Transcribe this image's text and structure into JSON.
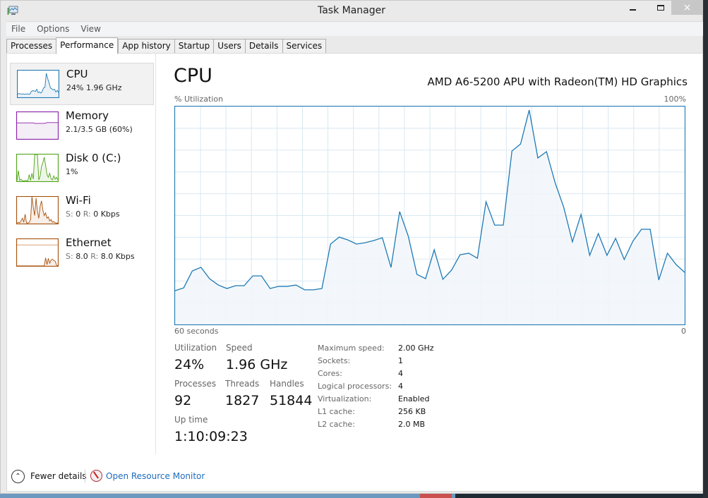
{
  "window": {
    "title": "Task Manager",
    "app_icon": "task-manager-icon",
    "controls": {
      "minimize": "minimize-icon",
      "maximize": "maximize-icon",
      "close": "×"
    }
  },
  "menu": [
    "File",
    "Options",
    "View"
  ],
  "tabs": [
    {
      "label": "Processes",
      "active": false
    },
    {
      "label": "Performance",
      "active": true
    },
    {
      "label": "App history",
      "active": false
    },
    {
      "label": "Startup",
      "active": false
    },
    {
      "label": "Users",
      "active": false
    },
    {
      "label": "Details",
      "active": false
    },
    {
      "label": "Services",
      "active": false
    }
  ],
  "sidebar": {
    "items": [
      {
        "name": "CPU",
        "sub": "24%  1.96 GHz",
        "color": "#1f7ab5",
        "fill": "#eaf2f8",
        "selected": true
      },
      {
        "name": "Memory",
        "sub": "2.1/3.5 GB (60%)",
        "color": "#8b1fa9",
        "fill": "#f4eef6",
        "selected": false
      },
      {
        "name": "Disk 0 (C:)",
        "sub": "1%",
        "color": "#4fa419",
        "fill": "#eef6e8",
        "selected": false
      },
      {
        "name": "Wi-Fi",
        "sub_parts": {
          "s_label": "S:",
          "s_value": "0",
          "r_label": "R:",
          "r_value": "0 Kbps"
        },
        "color": "#a7500b",
        "fill": "#f7efe8",
        "selected": false
      },
      {
        "name": "Ethernet",
        "sub_parts": {
          "s_label": "S:",
          "s_value": "8.0",
          "r_label": "R:",
          "r_value": "8.0 Kbps"
        },
        "color": "#a7500b",
        "fill": "#f7efe8",
        "selected": false
      }
    ]
  },
  "main": {
    "title": "CPU",
    "model": "AMD A6-5200 APU with Radeon(TM) HD Graphics",
    "stats": {
      "utilization_label": "Utilization",
      "utilization": "24%",
      "speed_label": "Speed",
      "speed": "1.96 GHz",
      "processes_label": "Processes",
      "processes": "92",
      "threads_label": "Threads",
      "threads": "1827",
      "handles_label": "Handles",
      "handles": "51844",
      "uptime_label": "Up time",
      "uptime": "1:10:09:23"
    },
    "details": [
      {
        "label": "Maximum speed:",
        "value": "2.00 GHz"
      },
      {
        "label": "Sockets:",
        "value": "1"
      },
      {
        "label": "Cores:",
        "value": "4"
      },
      {
        "label": "Logical processors:",
        "value": "4"
      },
      {
        "label": "Virtualization:",
        "value": "Enabled"
      },
      {
        "label": "L1 cache:",
        "value": "256 KB"
      },
      {
        "label": "L2 cache:",
        "value": "2.0 MB"
      }
    ]
  },
  "footer": {
    "fewer_details": "Fewer details",
    "open_resource_monitor": "Open Resource Monitor"
  },
  "chart_data": {
    "type": "area",
    "title": "CPU",
    "ylabel": "% Utilization",
    "ymax_label": "100%",
    "xlabel_left": "60 seconds",
    "xlabel_right": "0",
    "ylim": [
      0,
      100
    ],
    "xlim": [
      60,
      0
    ],
    "grid": true,
    "grid_rows": 10,
    "grid_cols": 20,
    "line_color": "#1f7ab5",
    "fill_color": "#f1f6fa",
    "grid_color": "#d9e8f2",
    "series": [
      {
        "name": "CPU",
        "values": [
          15.5,
          16.8,
          24.6,
          26.2,
          21.0,
          18.1,
          16.5,
          17.8,
          17.8,
          22.3,
          22.3,
          16.5,
          17.5,
          17.5,
          18.1,
          15.9,
          15.9,
          16.5,
          36.9,
          40.1,
          38.8,
          36.9,
          37.5,
          38.5,
          39.8,
          26.2,
          51.8,
          40.5,
          23.0,
          21.0,
          34.3,
          20.7,
          24.9,
          32.0,
          32.7,
          30.4,
          56.3,
          45.6,
          45.6,
          79.6,
          82.8,
          98.4,
          76.4,
          79.3,
          65.0,
          53.7,
          37.9,
          50.5,
          31.7,
          41.7,
          31.7,
          39.5,
          29.8,
          38.2,
          43.7,
          43.7,
          20.4,
          32.7,
          27.5,
          23.9
        ]
      }
    ]
  },
  "sparklines": {
    "cpu": [
      12,
      14,
      13,
      12,
      13,
      12,
      12,
      13,
      12,
      12,
      22,
      25,
      24,
      22,
      30,
      18,
      20,
      16,
      22,
      35,
      38,
      90,
      70,
      55,
      35,
      32,
      28,
      30,
      20,
      26,
      18
    ],
    "memory": [
      60,
      60,
      60,
      60,
      60,
      60,
      60,
      60,
      60,
      60,
      60,
      60,
      60,
      58,
      58,
      58,
      58,
      58,
      58,
      58,
      58,
      59,
      61,
      61,
      61,
      61,
      61,
      61,
      61,
      61,
      61
    ],
    "disk": [
      2,
      40,
      3,
      8,
      2,
      1,
      3,
      2,
      2,
      25,
      3,
      30,
      8,
      100,
      100,
      100,
      5,
      20,
      55,
      70,
      90,
      60,
      25,
      15,
      30,
      10,
      5,
      20,
      8,
      15,
      5
    ],
    "wifi": [
      2,
      5,
      3,
      10,
      20,
      5,
      35,
      3,
      2,
      5,
      15,
      100,
      60,
      30,
      95,
      45,
      20,
      65,
      85,
      50,
      30,
      40,
      20,
      25,
      10,
      15,
      5,
      8,
      3,
      2,
      2
    ],
    "ethernet": [
      0,
      0,
      0,
      0,
      0,
      0,
      0,
      0,
      0,
      0,
      0,
      0,
      0,
      0,
      0,
      0,
      0,
      0,
      0,
      0,
      0,
      30,
      5,
      28,
      10,
      22,
      25,
      20,
      18,
      3,
      0
    ],
    "ethernet_ceiling": 80
  }
}
